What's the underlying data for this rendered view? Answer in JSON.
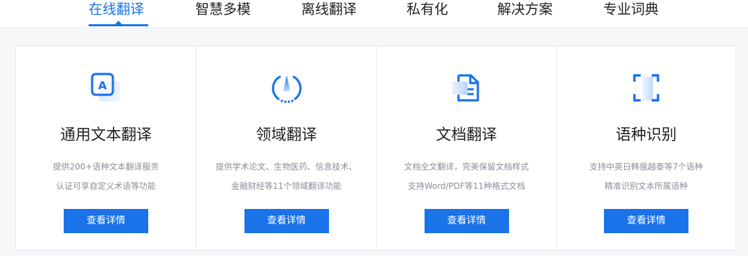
{
  "tabs": [
    {
      "label": "在线翻译",
      "active": true
    },
    {
      "label": "智慧多模",
      "active": false
    },
    {
      "label": "离线翻译",
      "active": false
    },
    {
      "label": "私有化",
      "active": false
    },
    {
      "label": "解决方案",
      "active": false
    },
    {
      "label": "专业词典",
      "active": false
    }
  ],
  "cards": [
    {
      "icon": "text-translate-icon",
      "title": "通用文本翻译",
      "desc": [
        "提供200+语种文本翻译服务",
        "认证可享自定义术语等功能"
      ],
      "button": "查看详情"
    },
    {
      "icon": "domain-icon",
      "title": "领域翻译",
      "desc": [
        "提供学术论文、生物医药、信息技术、",
        "金融财经等11个领域翻译功能"
      ],
      "button": "查看详情"
    },
    {
      "icon": "document-icon",
      "title": "文档翻译",
      "desc": [
        "文档全文翻译，完美保留文档样式",
        "支持Word/PDF等11种格式文档"
      ],
      "button": "查看详情"
    },
    {
      "icon": "language-detect-icon",
      "title": "语种识别",
      "desc": [
        "支持中英日韩俄越泰等7个语种",
        "精准识别文本所属语种"
      ],
      "button": "查看详情"
    }
  ],
  "colors": {
    "accent": "#1a73e8",
    "title": "#222222",
    "desc": "#8a8f99"
  }
}
